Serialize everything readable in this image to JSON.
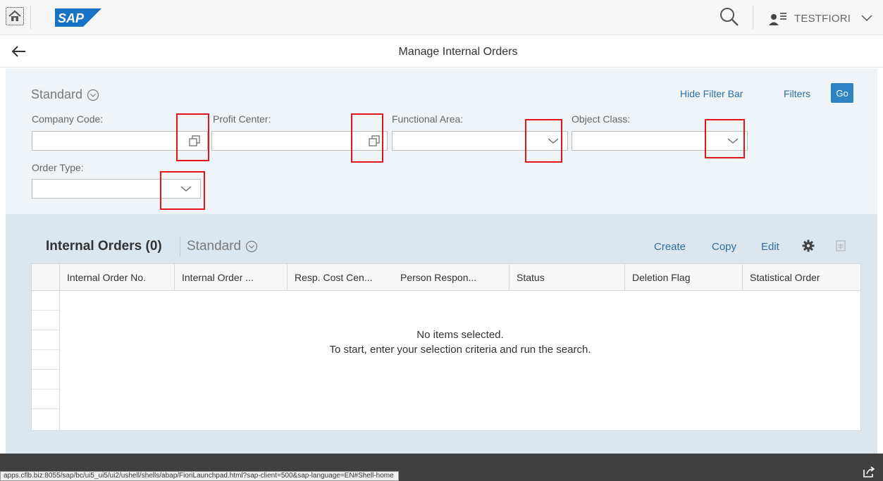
{
  "shell": {
    "logo_text": "SAP",
    "user_name": "TESTFIORI"
  },
  "titlebar": {
    "title": "Manage Internal Orders"
  },
  "filter_bar": {
    "variant": "Standard",
    "hide_filter_bar_label": "Hide Filter Bar",
    "filters_label": "Filters",
    "go_label": "Go",
    "fields": [
      {
        "label": "Company Code:",
        "value": "",
        "button_icon": "value-help-icon"
      },
      {
        "label": "Profit Center:",
        "value": "",
        "button_icon": "value-help-icon"
      },
      {
        "label": "Functional Area:",
        "value": "",
        "button_icon": "chevron-down-icon"
      },
      {
        "label": "Object Class:",
        "value": "",
        "button_icon": "chevron-down-icon"
      },
      {
        "label": "Order Type:",
        "value": "",
        "button_icon": "chevron-down-icon"
      }
    ]
  },
  "table": {
    "title": "Internal Orders (0)",
    "variant": "Standard",
    "actions": {
      "create": "Create",
      "copy": "Copy",
      "edit": "Edit"
    },
    "columns": [
      "Internal Order No.",
      "Internal Order ...",
      "Resp. Cost Cen...",
      "Person Respon...",
      "Status",
      "Deletion Flag",
      "Statistical Order"
    ],
    "empty_line1": "No items selected.",
    "empty_line2": "To start, enter your selection criteria and run the search."
  },
  "status_bar": {
    "url": "apps.cflb.biz:8055/sap/bc/ui5_ui5/ui2/ushell/shells/abap/FioriLaunchpad.html?sap-client=500&sap-language=EN#Shell-home"
  },
  "colors": {
    "accent": "#2f84c6",
    "link": "#2f6ea7",
    "highlight_box": "#e1161b",
    "footer": "#404040"
  }
}
